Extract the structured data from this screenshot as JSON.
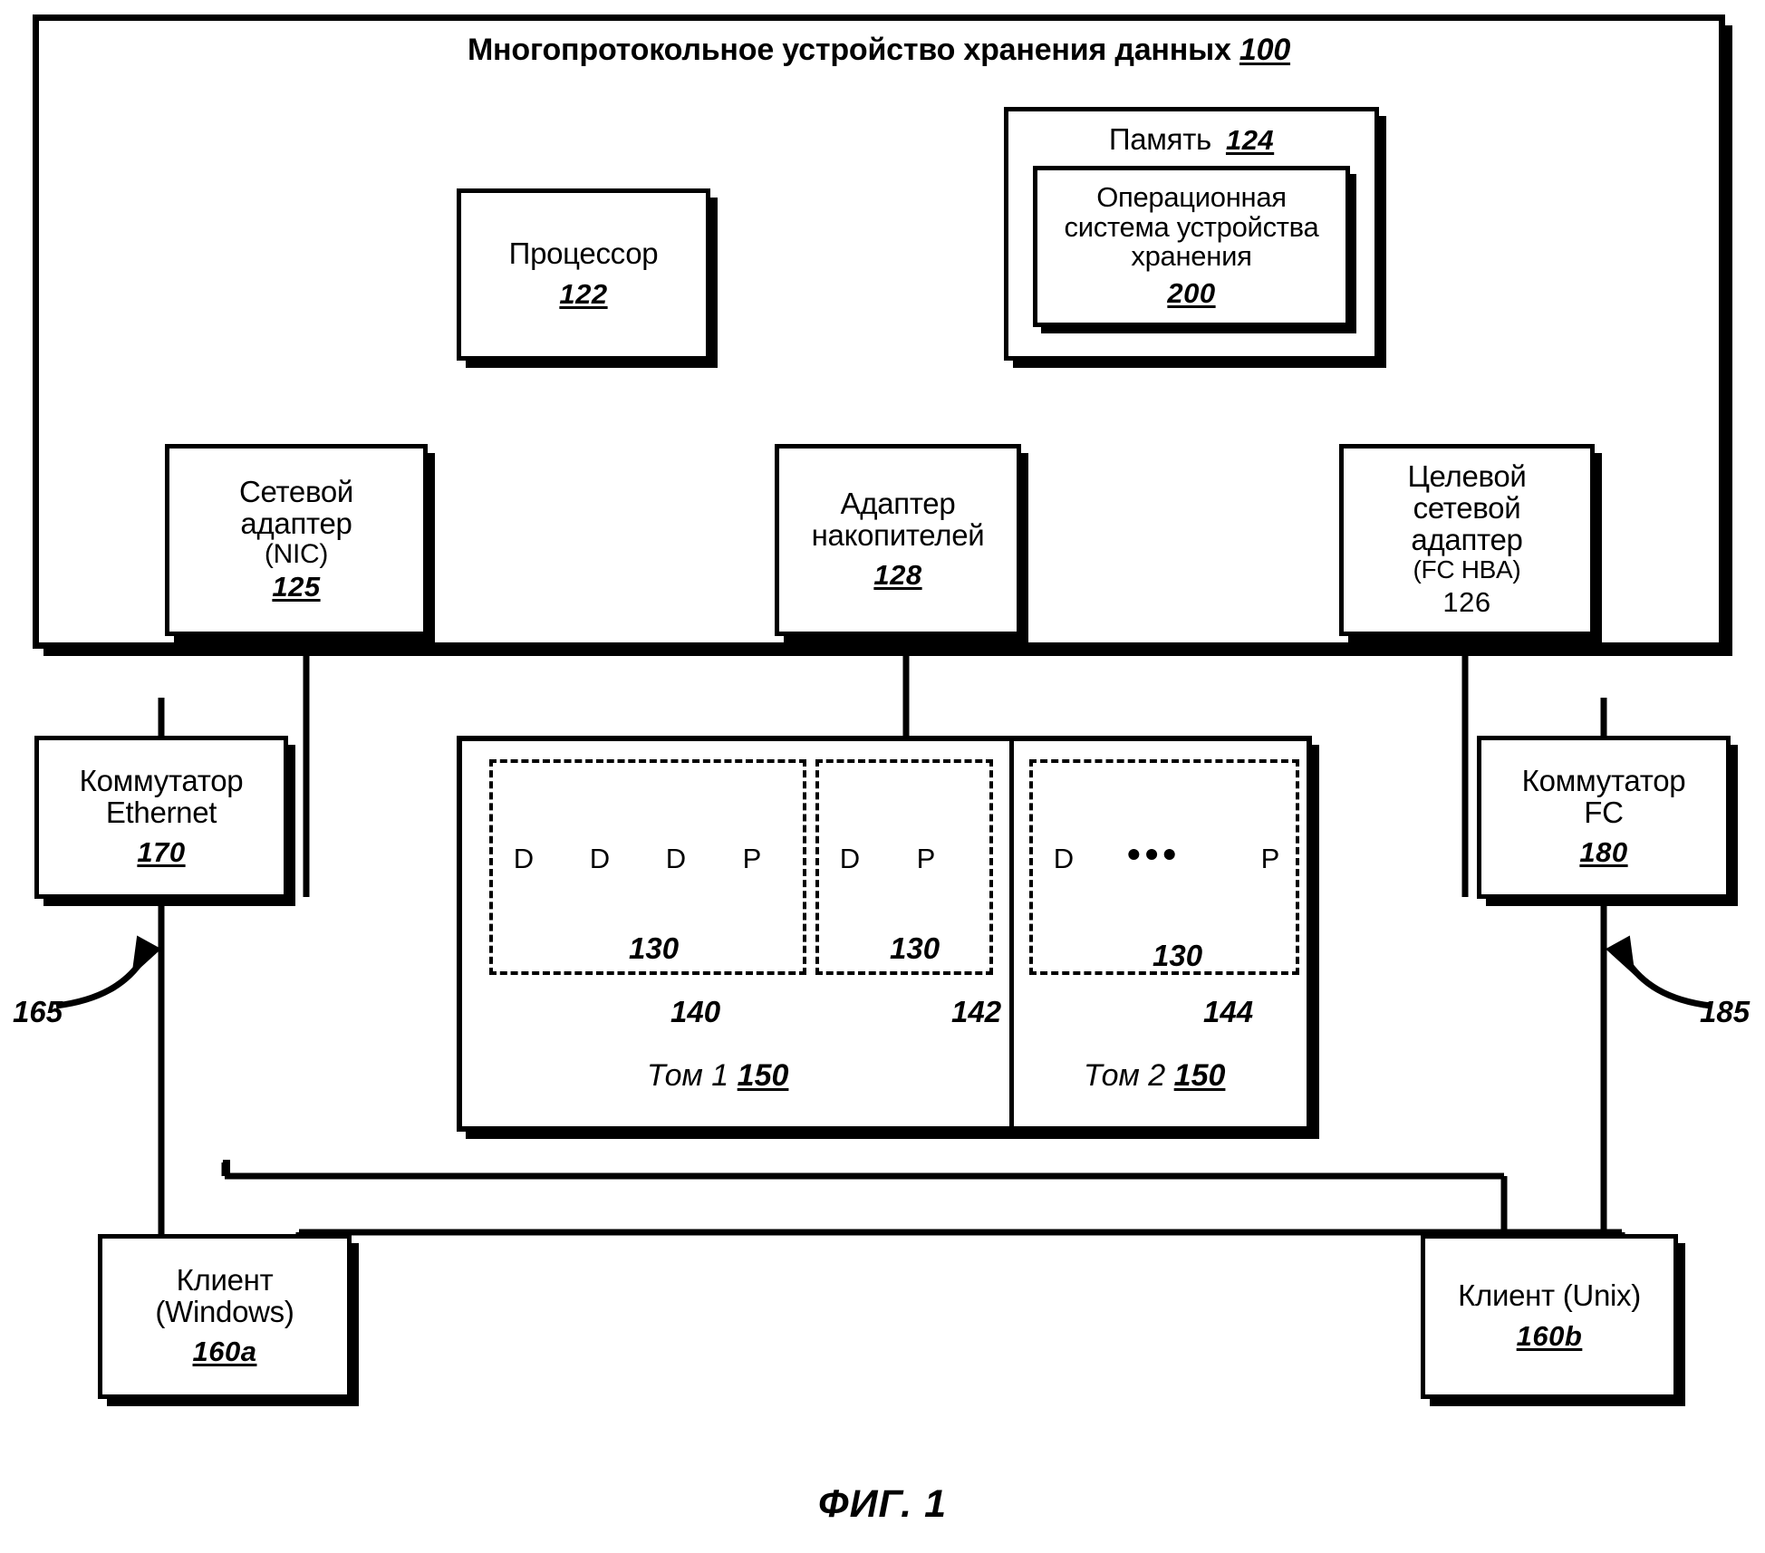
{
  "figure": {
    "caption": "ФИГ. 1",
    "frame_title": "Многопротокольное устройство хранения данных",
    "frame_ref": "100"
  },
  "components": {
    "processor": {
      "title": "Процессор",
      "ref": "122"
    },
    "memory": {
      "title": "Память",
      "ref": "124"
    },
    "storage_os": {
      "title": "Операционная\nсистема устройства\nхранения",
      "ref": "200"
    },
    "nic": {
      "title": "Сетевой\nадаптер",
      "sub": "(NIC)",
      "ref": "125"
    },
    "storage_adapter": {
      "title": "Адаптер\nнакопителей",
      "ref": "128"
    },
    "fc_hba": {
      "title": "Целевой\nсетевой\nадаптер",
      "sub": "(FC HBA)",
      "ref": "126"
    },
    "ethernet_switch": {
      "title": "Коммутатор\nEthernet",
      "ref": "170"
    },
    "fc_switch": {
      "title": "Коммутатор\nFC",
      "ref": "180"
    },
    "client_windows": {
      "title": "Клиент\n(Windows)",
      "ref": "160a"
    },
    "client_unix": {
      "title": "Клиент (Unix)",
      "ref": "160b"
    }
  },
  "network_refs": {
    "ethernet_network": "165",
    "fc_network": "185"
  },
  "volumes": [
    {
      "label": "Том 1",
      "ref": "150"
    },
    {
      "label": "Том 2",
      "ref": "150"
    }
  ],
  "raid_groups": [
    {
      "ref": "140",
      "disk_ref": "130",
      "disks": [
        "D",
        "D",
        "D",
        "P"
      ],
      "ellipsis": false
    },
    {
      "ref": "142",
      "disk_ref": "130",
      "disks": [
        "D",
        "P"
      ],
      "ellipsis": false
    },
    {
      "ref": "144",
      "disk_ref": "130",
      "disks": [
        "D",
        "P"
      ],
      "ellipsis": true
    }
  ],
  "colors": {
    "ink": "#000000",
    "paper": "#ffffff"
  }
}
